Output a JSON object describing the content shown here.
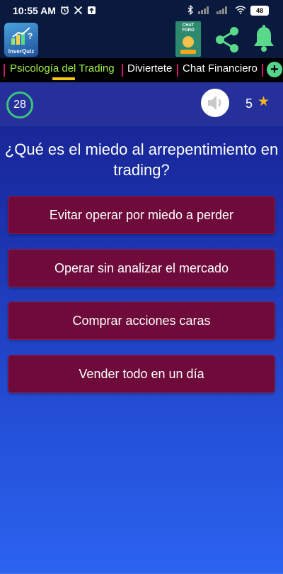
{
  "status_bar": {
    "time": "10:55 AM",
    "left_icons": [
      "alarm-icon",
      "x-icon",
      "upload-icon"
    ],
    "right_icons": [
      "bluetooth-icon",
      "signal-icon",
      "signal-icon",
      "wifi-icon"
    ],
    "battery": "48"
  },
  "app_bar": {
    "logo_text": "InverQuiz",
    "chat_foro_text": "CHAT FORO",
    "accent": "#5ad98b"
  },
  "tabs": {
    "items": [
      {
        "label": "Psicología del Trading",
        "active": true
      },
      {
        "label": "Diviertete",
        "active": false
      },
      {
        "label": "Chat Financiero",
        "active": false
      }
    ],
    "active_color": "#9ef04d",
    "separator_color": "#d8116e"
  },
  "quiz": {
    "timer": "28",
    "score": "5",
    "question": "¿Qué es el miedo al arrepentimiento en trading?",
    "answers": [
      "Evitar operar por miedo a perder",
      "Operar sin analizar el mercado",
      "Comprar acciones caras",
      "Vender todo en un día"
    ],
    "answer_color": "#6e0b3a"
  }
}
